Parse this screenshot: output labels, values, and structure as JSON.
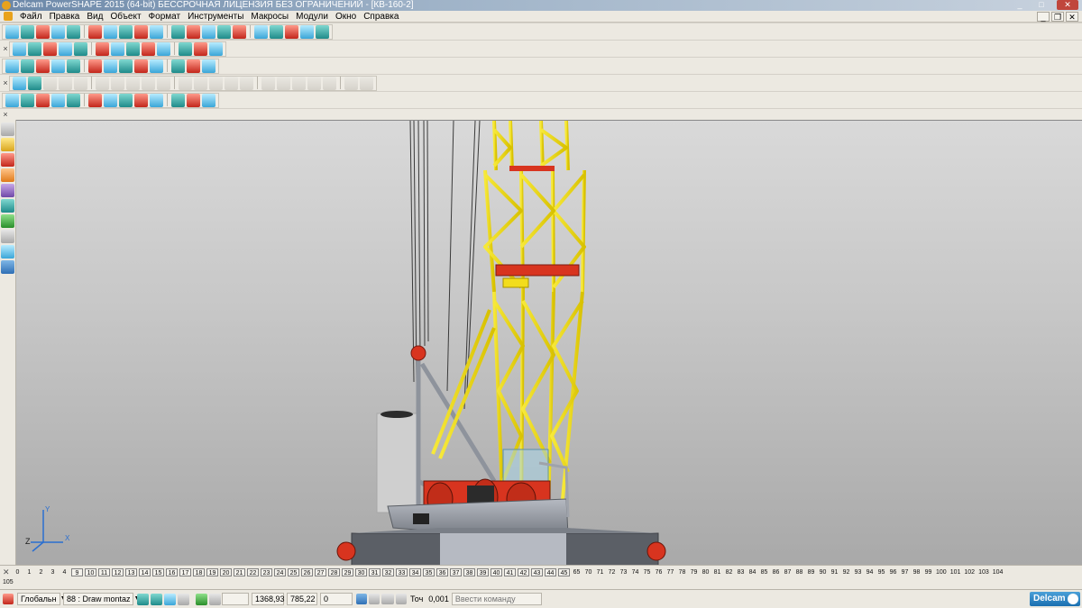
{
  "window": {
    "title": "Delcam PowerSHAPE 2015 (64-bit) БЕССРОЧНАЯ ЛИЦЕНЗИЯ БЕЗ ОГРАНИЧЕНИЙ - [КВ-160-2]",
    "minimize": "_",
    "maximize": "□",
    "close": "✕",
    "mdi_minimize": "_",
    "mdi_restore": "❐",
    "mdi_close": "✕"
  },
  "menu": [
    "Файл",
    "Правка",
    "Вид",
    "Объект",
    "Формат",
    "Инструменты",
    "Макросы",
    "Модули",
    "Окно",
    "Справка"
  ],
  "toolbars": {
    "handle": "×",
    "row1_icons": [
      "new-model-icon",
      "open-icon",
      "save-icon",
      "print-icon",
      "import-icon",
      "undo-icon",
      "redo-icon",
      "cut-icon",
      "copy-icon",
      "paste-icon",
      "delete-icon",
      "line-icon",
      "arc-icon",
      "circle-icon",
      "curve-icon",
      "text-icon",
      "dimension-icon",
      "solid-icon",
      "surface-icon",
      "tools-icon"
    ],
    "row2_icons": [
      "view-front-icon",
      "view-top-icon",
      "view-iso-icon",
      "view-cube-icon",
      "zoom-icon",
      "zoom-fit-icon",
      "zoom-in-icon",
      "zoom-out-icon",
      "pan-icon",
      "rotate-icon",
      "shade-icon",
      "light-icon",
      "hand-icon"
    ],
    "row3_icons": [
      "layer-icon",
      "box-icon",
      "sheet-icon",
      "sphere-icon",
      "cone-icon",
      "torus-icon",
      "extrude-icon",
      "revolve-icon",
      "cube-icon",
      "wire-icon",
      "render-icon",
      "material-icon",
      "paint-icon"
    ],
    "row4_icons": [
      "feature-icon",
      "hole-icon",
      "fillet-icon",
      "chamfer-icon",
      "shell-icon",
      "boolean-icon",
      "cut-feature-icon",
      "pattern-icon",
      "mirror-icon",
      "scale-icon",
      "move-icon",
      "offset-icon",
      "blend-icon",
      "draft-icon",
      "thicken-icon",
      "split-icon",
      "trim-icon",
      "extend-icon",
      "flip-icon",
      "sew-icon",
      "heal-icon",
      "measure-icon"
    ],
    "row5_icons": [
      "select-wire-icon",
      "trim-curve-icon",
      "select-solid-icon",
      "assembly-icon",
      "component-icon",
      "gear-icon",
      "electrode-icon",
      "mould-icon",
      "sheet-metal-icon",
      "wizard-icon",
      "smart-icon",
      "note-icon",
      "drawing-icon"
    ]
  },
  "left_toolbar_icons": [
    "select-arrow-icon",
    "quick-select-icon",
    "lines-icon",
    "arcs-icon",
    "curves-icon",
    "surfaces-icon",
    "solids-icon",
    "features-icon",
    "workplanes-icon",
    "drafting-icon"
  ],
  "viewport": {
    "description_colors": {
      "tower": "#f2dd1c",
      "tower_edge": "#b8a200",
      "winch": "#d8341f",
      "platform": "#8f939a",
      "cables": "#3a3a3a"
    },
    "axis_labels": [
      "Z",
      "X",
      "Y"
    ]
  },
  "levels": {
    "numbers_plain_start": [
      "0",
      "1",
      "2",
      "3",
      "4"
    ],
    "numbers_boxed": [
      "9",
      "10",
      "11",
      "12",
      "13",
      "14",
      "15",
      "16",
      "17",
      "18",
      "19",
      "20",
      "21",
      "22",
      "23",
      "24",
      "25",
      "26",
      "27",
      "28",
      "29",
      "30",
      "31",
      "32",
      "33",
      "34",
      "35",
      "36",
      "37",
      "38",
      "39",
      "40",
      "41",
      "42",
      "43",
      "44",
      "45"
    ],
    "numbers_plain_end": [
      "65",
      "70",
      "71",
      "72",
      "73",
      "74",
      "75",
      "76",
      "77",
      "78",
      "79",
      "80",
      "81",
      "82",
      "83",
      "84",
      "85",
      "86",
      "87",
      "88",
      "89",
      "90",
      "91",
      "92",
      "93",
      "94",
      "95",
      "96",
      "97",
      "98",
      "99",
      "100",
      "101",
      "102",
      "103",
      "104"
    ],
    "overflow": "105",
    "close": "✕"
  },
  "status": {
    "workplane": "Глобальн",
    "level_number": "88",
    "level_name": "Draw montaz",
    "x": "1368,93",
    "y": "785,22",
    "z": "0",
    "tolerance_label": "Точ",
    "tolerance": "0,001",
    "command_placeholder": "Ввести команду",
    "logo": "Delcam"
  }
}
